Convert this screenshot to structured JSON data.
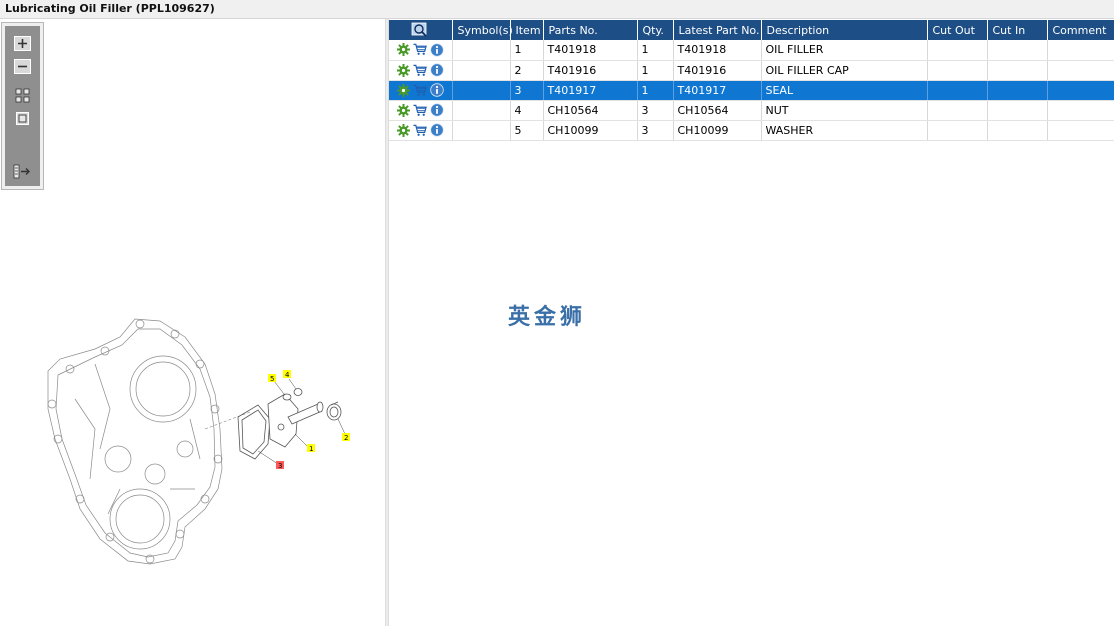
{
  "window": {
    "title": "Lubricating Oil Filler (PPL109627)"
  },
  "table": {
    "columns": [
      "Symbol(s)",
      "Item",
      "Parts No.",
      "Qty.",
      "Latest Part No.",
      "Description",
      "Cut Out",
      "Cut In",
      "Comment"
    ],
    "rows": [
      {
        "item": "1",
        "part_no": "T401918",
        "qty": "1",
        "latest": "T401918",
        "desc": "OIL FILLER",
        "cut_out": "",
        "cut_in": "",
        "comment": ""
      },
      {
        "item": "2",
        "part_no": "T401916",
        "qty": "1",
        "latest": "T401916",
        "desc": "OIL FILLER CAP",
        "cut_out": "",
        "cut_in": "",
        "comment": ""
      },
      {
        "item": "3",
        "part_no": "T401917",
        "qty": "1",
        "latest": "T401917",
        "desc": "SEAL",
        "cut_out": "",
        "cut_in": "",
        "comment": ""
      },
      {
        "item": "4",
        "part_no": "CH10564",
        "qty": "3",
        "latest": "CH10564",
        "desc": "NUT",
        "cut_out": "",
        "cut_in": "",
        "comment": ""
      },
      {
        "item": "5",
        "part_no": "CH10099",
        "qty": "3",
        "latest": "CH10099",
        "desc": "WASHER",
        "cut_out": "",
        "cut_in": "",
        "comment": ""
      }
    ],
    "selected_item": "3"
  },
  "watermark": {
    "text": "英金狮"
  },
  "diagram": {
    "callouts": [
      {
        "label": "1",
        "color": "#ffff00"
      },
      {
        "label": "2",
        "color": "#ffff00"
      },
      {
        "label": "3",
        "color": "#ff5a5a"
      },
      {
        "label": "4",
        "color": "#ffff00"
      },
      {
        "label": "5",
        "color": "#ffff00"
      }
    ]
  },
  "icons": {
    "toolbox": [
      "zoom-in-icon",
      "zoom-out-icon",
      "fit-all-icon",
      "fit-window-icon",
      "toggle-list-icon"
    ],
    "header": "search-view-icon",
    "row": [
      "gear-icon",
      "cart-icon",
      "info-icon"
    ]
  },
  "colors": {
    "header_bg": "#1d4e85",
    "selected_row": "#0f77d2",
    "toolbox_bg": "#8f8f8f"
  }
}
